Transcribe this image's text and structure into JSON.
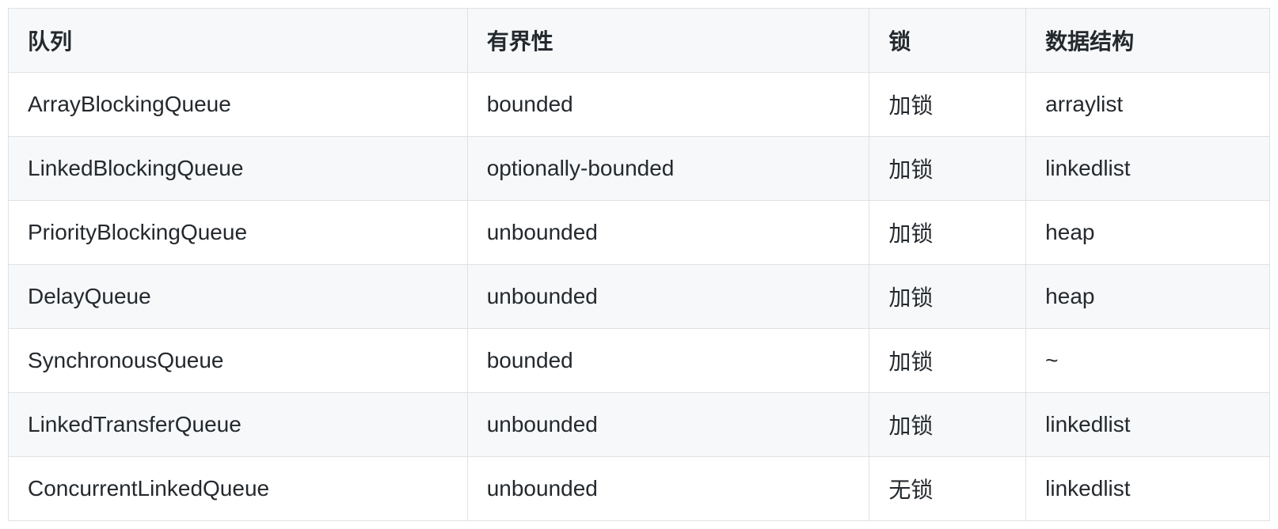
{
  "table": {
    "headers": {
      "queue": "队列",
      "bounded": "有界性",
      "lock": "锁",
      "datastructure": "数据结构"
    },
    "rows": [
      {
        "queue": "ArrayBlockingQueue",
        "bounded": "bounded",
        "lock": "加锁",
        "datastructure": "arraylist"
      },
      {
        "queue": "LinkedBlockingQueue",
        "bounded": "optionally-bounded",
        "lock": "加锁",
        "datastructure": "linkedlist"
      },
      {
        "queue": "PriorityBlockingQueue",
        "bounded": "unbounded",
        "lock": "加锁",
        "datastructure": "heap"
      },
      {
        "queue": "DelayQueue",
        "bounded": "unbounded",
        "lock": "加锁",
        "datastructure": "heap"
      },
      {
        "queue": "SynchronousQueue",
        "bounded": "bounded",
        "lock": "加锁",
        "datastructure": "~"
      },
      {
        "queue": "LinkedTransferQueue",
        "bounded": "unbounded",
        "lock": "加锁",
        "datastructure": "linkedlist"
      },
      {
        "queue": "ConcurrentLinkedQueue",
        "bounded": "unbounded",
        "lock": "无锁",
        "datastructure": "linkedlist"
      }
    ]
  }
}
